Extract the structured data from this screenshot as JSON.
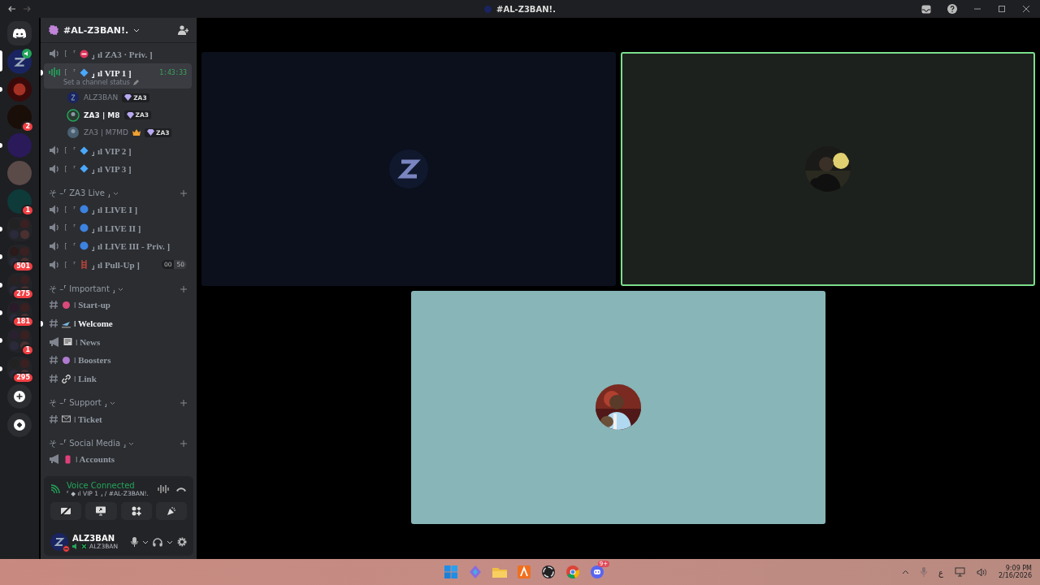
{
  "titlebar": {
    "title": "#AL-Z3BAN!."
  },
  "servers": [
    {
      "kind": "home",
      "selected": false,
      "unread": false
    },
    {
      "kind": "server",
      "selected": true,
      "unread": false,
      "voice": true
    },
    {
      "kind": "server",
      "selected": false,
      "unread": true
    },
    {
      "kind": "server",
      "selected": false,
      "unread": false,
      "badge": "2"
    },
    {
      "kind": "server",
      "selected": false,
      "unread": true
    },
    {
      "kind": "server",
      "selected": false,
      "unread": false
    },
    {
      "kind": "server",
      "selected": false,
      "unread": false,
      "badge": "1"
    },
    {
      "kind": "folder",
      "selected": false,
      "unread": true
    },
    {
      "kind": "folder",
      "selected": false,
      "unread": true,
      "badge": "501"
    },
    {
      "kind": "folder",
      "selected": false,
      "unread": true,
      "badge": "275"
    },
    {
      "kind": "folder",
      "selected": false,
      "unread": true,
      "badge": "181"
    },
    {
      "kind": "folder",
      "selected": false,
      "unread": true,
      "badge": "1"
    },
    {
      "kind": "folder",
      "selected": false,
      "unread": true,
      "badge": "295"
    },
    {
      "kind": "add",
      "selected": false,
      "unread": false
    },
    {
      "kind": "discover",
      "selected": false,
      "unread": false
    }
  ],
  "server_header": {
    "name": "#AL-Z3BAN!."
  },
  "sections": [
    {
      "items": [
        {
          "kind": "voice",
          "pre": "[ ⸢",
          "label": "⸥ ıl ZA3 · Priv. ]",
          "selected": false,
          "unread": false
        },
        {
          "kind": "voice",
          "pre": "[ ⸢",
          "label": "⸥ ıl VIP 1 ]",
          "selected": true,
          "unread": true,
          "time": "1:43:33",
          "status": "Set a channel status",
          "members": [
            {
              "name": "ALZ3BAN",
              "speaking": false,
              "muted": true,
              "crown": false,
              "tag": "ZA3"
            },
            {
              "name": "ZA3 | M8",
              "speaking": true,
              "muted": false,
              "crown": false,
              "tag": "ZA3"
            },
            {
              "name": "ZA3 | M7MD",
              "speaking": false,
              "muted": true,
              "crown": true,
              "tag": "ZA3"
            }
          ]
        },
        {
          "kind": "voice",
          "pre": "[ ⸢",
          "label": "⸥ ıl VIP 2 ]",
          "selected": false,
          "unread": false
        },
        {
          "kind": "voice",
          "pre": "[ ⸢",
          "label": "⸥ ıl VIP 3 ]",
          "selected": false,
          "unread": false
        }
      ]
    },
    {
      "category": "そ –⸢ ZA3 Live ⸥",
      "items": [
        {
          "kind": "voice",
          "pre": "[ ⸢",
          "label": "⸥ ıl LIVE I ]",
          "selected": false,
          "unread": false
        },
        {
          "kind": "voice",
          "pre": "[ ⸢",
          "label": "⸥ ıl LIVE II ]",
          "selected": false,
          "unread": false
        },
        {
          "kind": "voice",
          "pre": "[ ⸢",
          "label": "⸥ ıl LIVE III - Priv. ]",
          "selected": false,
          "unread": false
        },
        {
          "kind": "voice",
          "pre": "[ ⸢",
          "label": "⸥ ıl Pull-Up ]",
          "selected": false,
          "unread": false,
          "limit": [
            "00",
            "50"
          ]
        }
      ]
    },
    {
      "category": "そ –⸢ Important ⸥",
      "items": [
        {
          "kind": "text",
          "label": "ǀ Start-up",
          "selected": false,
          "unread": false
        },
        {
          "kind": "text",
          "label": "ǀ Welcome",
          "selected": false,
          "unread": true
        },
        {
          "kind": "announce",
          "label": "ǀ News",
          "selected": false,
          "unread": false
        },
        {
          "kind": "text",
          "label": "ǀ Boosters",
          "selected": false,
          "unread": false
        },
        {
          "kind": "text",
          "label": "ǀ Link",
          "selected": false,
          "unread": false
        }
      ]
    },
    {
      "category": "そ –⸢ Support ⸥",
      "items": [
        {
          "kind": "text",
          "label": "ǀ Ticket",
          "selected": false,
          "unread": false
        }
      ]
    },
    {
      "category": "そ –⸢ Social Media ⸥",
      "items": [
        {
          "kind": "announce",
          "label": "ǀ Accounts",
          "selected": false,
          "unread": false
        }
      ]
    }
  ],
  "voice_panel": {
    "title": "Voice Connected",
    "channel": "⸢ ◆ ıl VIP 1 ⸥ / #AL-Z3BAN!."
  },
  "user_panel": {
    "name": "ALZ3BAN",
    "status": "ALZ3BAN"
  },
  "tiles": [
    {
      "color": "#0b101c",
      "speaking": false,
      "kind": "logo"
    },
    {
      "color": "#1d211e",
      "speaking": true,
      "kind": "picture"
    },
    {
      "color": "#87b5b8",
      "speaking": false,
      "kind": "picture"
    }
  ],
  "taskbar": {
    "apps": [
      {
        "kind": "start"
      },
      {
        "kind": "app-s"
      },
      {
        "kind": "files"
      },
      {
        "kind": "app-a"
      },
      {
        "kind": "obs"
      },
      {
        "kind": "chrome"
      },
      {
        "kind": "discord",
        "badge": "9+"
      }
    ],
    "language": "ع",
    "time": "9:09 PM",
    "date": "2/16/2026"
  }
}
